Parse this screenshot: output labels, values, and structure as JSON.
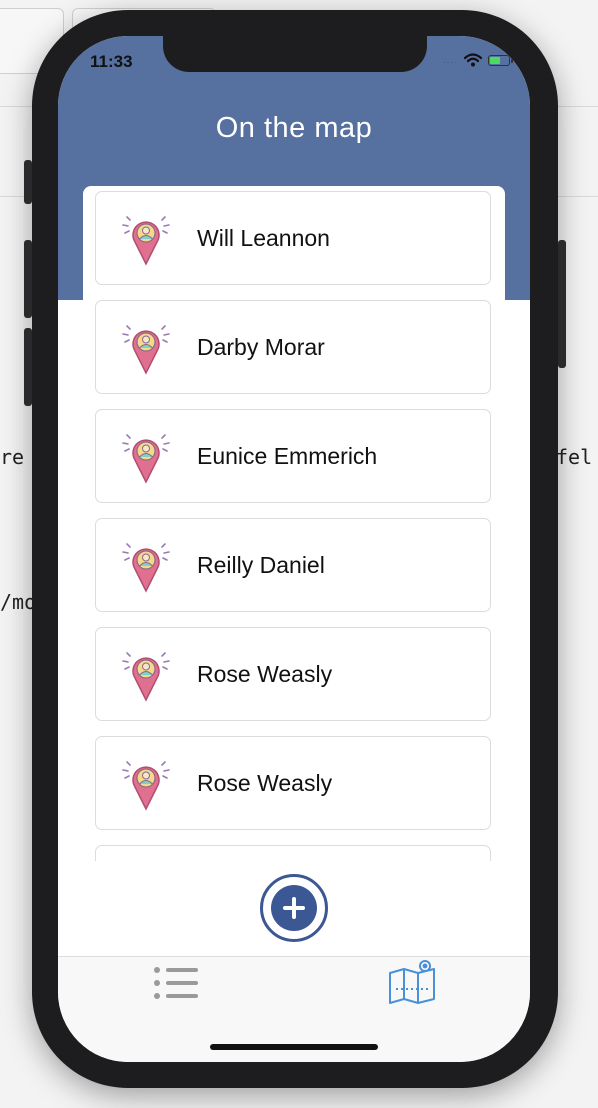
{
  "background": {
    "code_fragments": [
      "re",
      "fel",
      "/mo"
    ]
  },
  "status_bar": {
    "time": "11:33",
    "signal": "....",
    "battery_level": 0.6
  },
  "navigation": {
    "title": "On the map"
  },
  "list": {
    "items": [
      {
        "name": "Will Leannon",
        "icon": "person-location-pin-icon"
      },
      {
        "name": "Darby Morar",
        "icon": "person-location-pin-icon"
      },
      {
        "name": "Eunice Emmerich",
        "icon": "person-location-pin-icon"
      },
      {
        "name": "Reilly Daniel",
        "icon": "person-location-pin-icon"
      },
      {
        "name": "Rose Weasly",
        "icon": "person-location-pin-icon"
      },
      {
        "name": "Rose Weasly",
        "icon": "person-location-pin-icon"
      }
    ]
  },
  "add_button": {
    "icon": "plus-circle-icon"
  },
  "tab_bar": {
    "tabs": [
      {
        "icon": "list-icon",
        "selected": false
      },
      {
        "icon": "map-icon",
        "selected": true
      }
    ]
  },
  "colors": {
    "header": "#56709f",
    "accent": "#3b5794",
    "tab_active": "#4a90d9",
    "tab_inactive": "#9a9a9a",
    "pin": "#e0708f"
  }
}
